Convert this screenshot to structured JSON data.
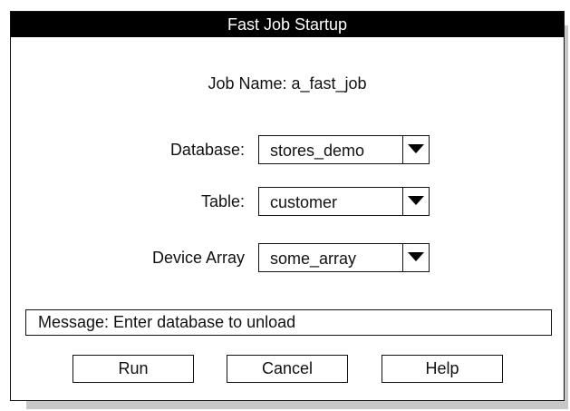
{
  "dialog": {
    "title": "Fast Job Startup",
    "job_name": "Job Name: a_fast_job"
  },
  "fields": {
    "database": {
      "label": "Database:",
      "value": "stores_demo",
      "icon": "dropdown-arrow-icon"
    },
    "table": {
      "label": "Table:",
      "value": "customer",
      "icon": "dropdown-arrow-icon"
    },
    "device_array": {
      "label": "Device Array",
      "value": "some_array",
      "icon": "dropdown-arrow-icon"
    }
  },
  "message": "Message: Enter database to unload",
  "buttons": {
    "run": "Run",
    "cancel": "Cancel",
    "help": "Help"
  }
}
